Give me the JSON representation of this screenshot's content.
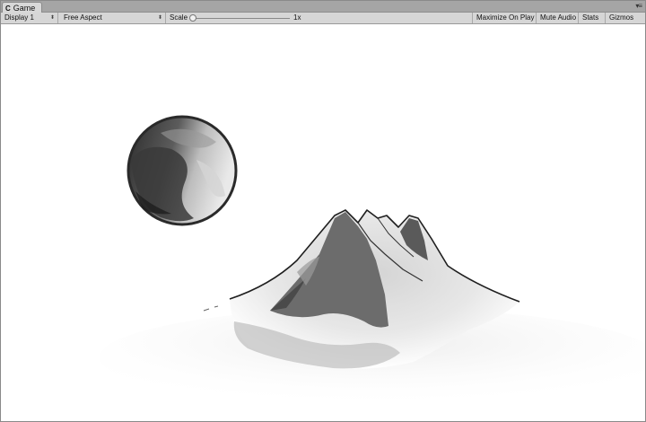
{
  "tab": {
    "icon": "game-icon",
    "title": "Game"
  },
  "toolbar": {
    "display": "Display 1",
    "aspect": "Free Aspect",
    "scale_label": "Scale",
    "scale_value": "1x",
    "scale_level": 0.0,
    "maximize": "Maximize On Play",
    "mute": "Mute Audio",
    "stats": "Stats",
    "gizmos": "Gizmos"
  },
  "scene": {
    "description_icons": [
      "moon-sphere",
      "snow-mountain"
    ],
    "colors": {
      "background": "#ffffff",
      "ink_dark": "#2a2a2a",
      "ink_mid": "#6e6e6e",
      "ink_light": "#cfcfcf"
    }
  }
}
